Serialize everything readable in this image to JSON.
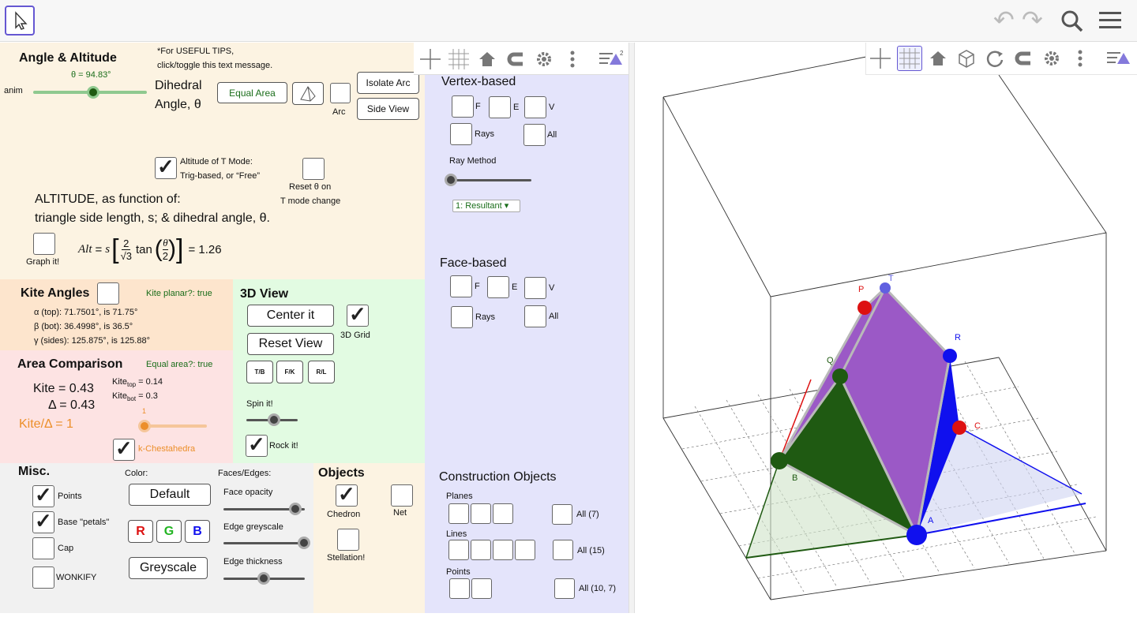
{
  "top": {
    "undo": "↶",
    "redo": "↷"
  },
  "angle": {
    "title": "Angle & Altitude",
    "theta_value": "θ = 94.83°",
    "anim": "anim",
    "dihedral1": "Dihedral",
    "dihedral2": "Angle, θ",
    "tips1": "*For USEFUL TIPS,",
    "tips2": "click/toggle this text message.",
    "equal_area": "Equal Area",
    "arc": "Arc",
    "isolate_arc": "Isolate Arc",
    "side_view": "Side View",
    "alt_mode1": "Altitude of T Mode:",
    "alt_mode2": "Trig-based, or “Free”",
    "reset1": "Reset θ on",
    "reset2": "T mode change",
    "altitude1": "ALTITUDE, as function of:",
    "altitude2": "triangle side length, s; & dihedral angle, θ.",
    "graph_it": "Graph it!",
    "formula_value": "= 1.26",
    "theta_slider": 0.51
  },
  "kite": {
    "title": "Kite Angles",
    "planar": "Kite planar?: true",
    "alpha": "α (top): 71.7501°, is  71.75°",
    "beta": "β (bot): 36.4998°, is  36.5°",
    "gamma": "γ (sides): 125.875°, is 125.88°"
  },
  "area": {
    "title": "Area Comparison",
    "equal": "Equal area?: true",
    "kite": "Kite = 0.43",
    "delta": "Δ = 0.43",
    "kite_top": "= 0.14",
    "kite_bot": "= 0.3",
    "ratio": "Kite/Δ = 1",
    "slider_label": "1",
    "chestahedra": "k-Chestahedra",
    "ratio_slider": 0.0
  },
  "view3d": {
    "title": "3D View",
    "center": "Center it",
    "reset": "Reset View",
    "grid": "3D Grid",
    "tb": "T/B",
    "fk": "F/K",
    "rl": "R/L",
    "spin": "Spin it!",
    "rock": "Rock it!",
    "spin_slider": 0.55
  },
  "misc": {
    "title": "Misc.",
    "points": "Points",
    "petals": "Base \"petals\"",
    "cap": "Cap",
    "wonkify": "WONKIFY",
    "color": "Color:",
    "default": "Default",
    "r": "R",
    "g": "G",
    "b": "B",
    "greyscale": "Greyscale",
    "faces_edges": "Faces/Edges:",
    "face_opacity": "Face opacity",
    "edge_grey": "Edge greyscale",
    "edge_thick": "Edge thickness",
    "opacity_slider": 0.87,
    "grey_slider": 1.0,
    "thick_slider": 0.5
  },
  "objects": {
    "title": "Objects",
    "chedron": "Chedron",
    "net": "Net",
    "stellation": "Stellation!"
  },
  "vertex": {
    "title": "Vertex-based",
    "f": "F",
    "e": "E",
    "v": "V",
    "rays": "Rays",
    "all": "All",
    "ray_method": "Ray Method",
    "select": "1: Resultant ▾",
    "ray_slider": 0.0
  },
  "face": {
    "title": "Face-based",
    "f": "F",
    "e": "E",
    "v": "V",
    "rays": "Rays",
    "all": "All"
  },
  "construction": {
    "title": "Construction Objects",
    "planes": "Planes",
    "planes_all": "All (7)",
    "lines": "Lines",
    "lines_all": "All (15)",
    "points": "Points",
    "points_all": "All (10, 7)"
  },
  "points3d": {
    "p": "P",
    "t": "T",
    "r": "R",
    "q": "Q",
    "c": "C",
    "b": "B",
    "a": "A"
  },
  "colors": {
    "purple": "#9b59c6",
    "green": "#1f5a12",
    "blue": "#1010ee",
    "red": "#dd1111",
    "accent": "#6557d2"
  }
}
